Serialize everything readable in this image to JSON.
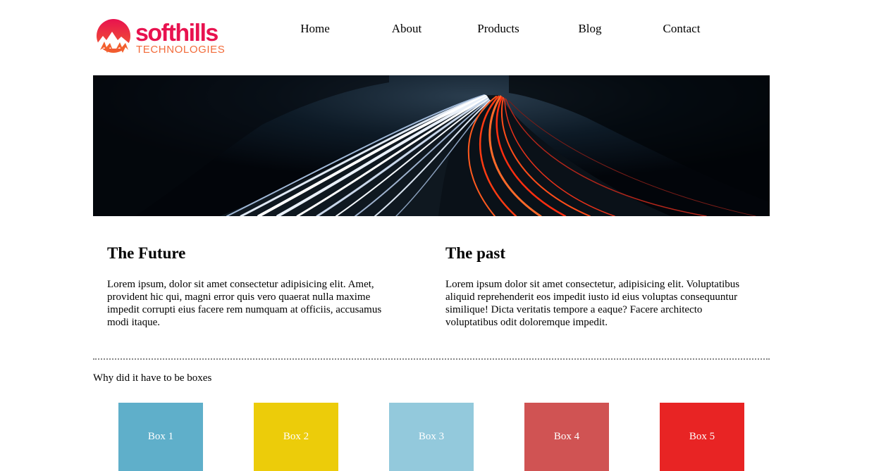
{
  "logo": {
    "wordmark": "softhills",
    "tagline": "TECHNOLOGIES"
  },
  "nav": {
    "items": [
      {
        "label": "Home"
      },
      {
        "label": "About"
      },
      {
        "label": "Products"
      },
      {
        "label": "Blog"
      },
      {
        "label": "Contact"
      }
    ]
  },
  "hero": {
    "image": "highway-light-trails"
  },
  "columns": [
    {
      "heading": "The Future",
      "text": "Lorem ipsum, dolor sit amet consectetur adipisicing elit. Amet, provident hic qui, magni error quis vero quaerat nulla maxime impedit corrupti eius facere rem numquam at officiis, accusamus modi itaque."
    },
    {
      "heading": "The past",
      "text": "Lorem ipsum dolor sit amet consectetur, adipisicing elit. Voluptatibus aliquid reprehenderit eos impedit iusto id eius voluptas consequuntur similique! Dicta veritatis tempore a eaque? Facere architecto voluptatibus odit doloremque impedit."
    }
  ],
  "boxes_section": {
    "title": "Why did it have to be boxes",
    "boxes": [
      {
        "label": "Box 1",
        "color": "#5fafca"
      },
      {
        "label": "Box 2",
        "color": "#eccc0a"
      },
      {
        "label": "Box 3",
        "color": "#93c9dc"
      },
      {
        "label": "Box 4",
        "color": "#d05353"
      },
      {
        "label": "Box 5",
        "color": "#e82424"
      }
    ]
  },
  "colors": {
    "brand": "#e8124f",
    "brand_secondary": "#f26b3a"
  }
}
